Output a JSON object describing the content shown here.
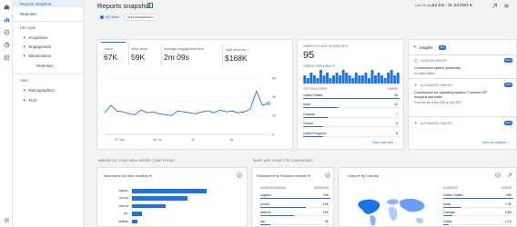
{
  "sidebar": {
    "items": [
      {
        "label": "Reports snapshot",
        "active": true
      },
      {
        "label": "Real-time"
      }
    ],
    "lifecycle_label": "Life cycle",
    "lifecycle_items": [
      {
        "label": "Acquisition"
      },
      {
        "label": "Engagement"
      },
      {
        "label": "Monetization"
      },
      {
        "label": "Retention"
      }
    ],
    "user_label": "User",
    "user_items": [
      {
        "label": "Demographics"
      },
      {
        "label": "Tech"
      }
    ]
  },
  "header": {
    "title": "Reports snapshot",
    "chip_users": "All Users",
    "chip_add": "Add comparison +",
    "date_prefix": "Last 28 days",
    "date_range": "24 Jun - 21 Jul 2021"
  },
  "metrics": [
    {
      "label": "Users",
      "value": "67K"
    },
    {
      "label": "New users",
      "value": "59K"
    },
    {
      "label": "Average engagement time",
      "value": "2m 09s"
    },
    {
      "label": "Total revenue",
      "value": "$168K"
    }
  ],
  "main_chart": {
    "y_ticks": [
      "6K",
      "4K",
      "2K",
      "0"
    ],
    "x_ticks": [
      "27 Jun",
      "04 Jul",
      "11",
      "18"
    ],
    "values": [
      2300,
      3100,
      2500,
      2400,
      2200,
      2100,
      2600,
      2300,
      2400,
      2200,
      2100,
      2000,
      2500,
      2400,
      2300,
      2200,
      2400,
      2500,
      2300,
      2600,
      2400,
      2500,
      2300,
      2400,
      2700,
      4600,
      3100,
      3300
    ],
    "y_max": 6000,
    "color": "#1a73e8"
  },
  "realtime": {
    "title": "USERS IN LAST 30 MINUTES",
    "value": "95",
    "per_minute_label": "USERS PER MINUTE",
    "per_minute": [
      3,
      2,
      4,
      3,
      2,
      5,
      3,
      4,
      2,
      3,
      4,
      3,
      5,
      4,
      3,
      2,
      4,
      3,
      3,
      4,
      2,
      5,
      3,
      4,
      3,
      2,
      4,
      5,
      3,
      4
    ],
    "table_header_left": "TOP COUNTRIES",
    "table_header_right": "USERS",
    "rows": [
      {
        "name": "United States",
        "value": "28",
        "fraction": 1.0
      },
      {
        "name": "India",
        "value": "10",
        "fraction": 0.36
      },
      {
        "name": "Canada",
        "value": "7",
        "fraction": 0.25
      },
      {
        "name": "France",
        "value": "6",
        "fraction": 0.21
      },
      {
        "name": "United Kingdom",
        "value": "6",
        "fraction": 0.21
      }
    ],
    "link": "View real time →"
  },
  "insights": {
    "title": "Insights",
    "badge": "10+",
    "items": [
      {
        "tag": "CUSTOM INSIGHT",
        "badge": "New",
        "headline": "Conversions spiked yesterday",
        "sub": "In United States"
      },
      {
        "tag": "AUTOMATED INSIGHT",
        "badge": "New",
        "headline": "Conversions for operating system \"Chrome OS\"",
        "headline2": "dropped last week",
        "sub": "From the 4th to the 10th of July 2021"
      },
      {
        "tag": "AUTOMATED INSIGHT",
        "badge": "New",
        "headline": "",
        "sub": ""
      }
    ],
    "link": "View all insights →"
  },
  "new_users": {
    "section": "WHERE DO YOUR NEW USERS COME FROM?",
    "card_title": "New users by User medium ▾",
    "rows": [
      {
        "label": "organic",
        "fraction": 1.0
      },
      {
        "label": "(none)",
        "fraction": 0.74
      },
      {
        "label": "referral",
        "fraction": 0.45
      },
      {
        "label": "cpc",
        "fraction": 0.14
      },
      {
        "label": "affiliate",
        "fraction": 0.07
      }
    ]
  },
  "campaigns": {
    "section": "WHAT ARE YOUR TOP CAMPAIGNS?",
    "card_title": "Sessions ▾ by Session medium ▾",
    "header_left": "SESSION MEDIUM",
    "header_right": "SESSIONS",
    "rows": [
      {
        "name": "organic",
        "value": "23K",
        "fraction": 1.0
      },
      {
        "name": "(none)",
        "value": "15K",
        "fraction": 0.65
      },
      {
        "name": "referral",
        "value": "11K",
        "fraction": 0.48
      },
      {
        "name": "cpc",
        "value": "3K",
        "fraction": 0.14
      }
    ]
  },
  "countries": {
    "card_title": "Users ▾ by Country",
    "header_left": "COUNTRY",
    "header_right": "USERS",
    "rows": [
      {
        "name": "United States",
        "value": "29K",
        "fraction": 1.0
      },
      {
        "name": "India",
        "value": "7.3K",
        "fraction": 0.25
      },
      {
        "name": "Canada",
        "value": "3.6K",
        "fraction": 0.13
      },
      {
        "name": "China",
        "value": "2.1K",
        "fraction": 0.08
      }
    ]
  }
}
